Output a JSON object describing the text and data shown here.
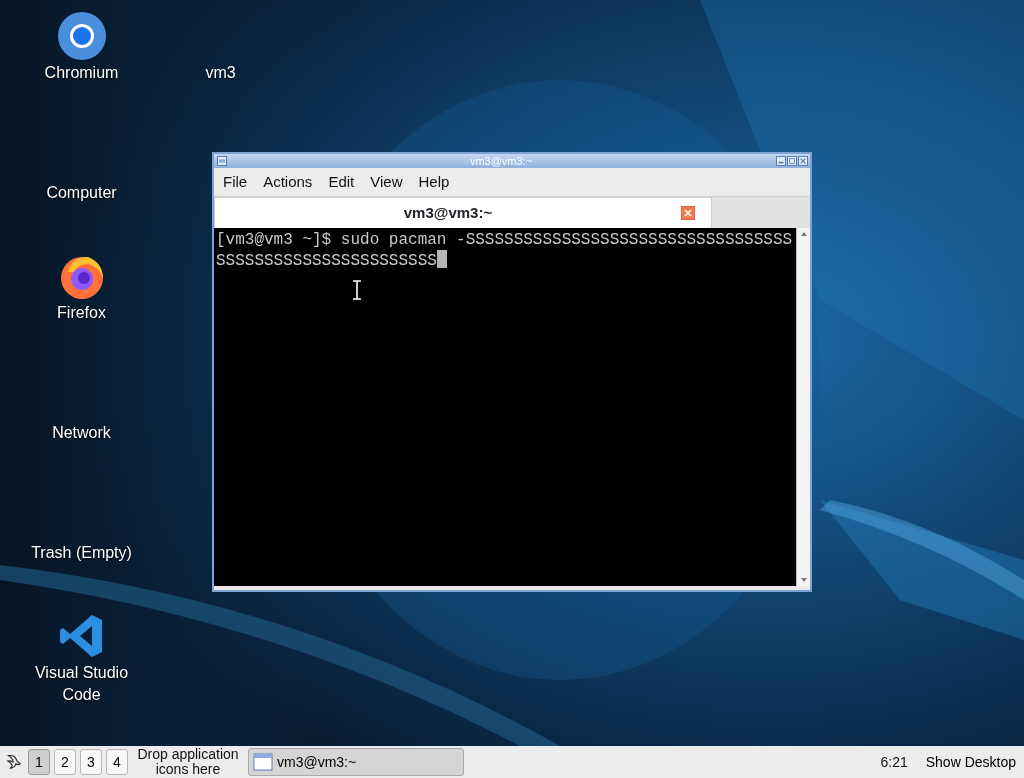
{
  "desktop_icons": [
    {
      "label": "Chromium",
      "kind": "chromium"
    },
    {
      "label": "Computer",
      "kind": "none"
    },
    {
      "label": "Firefox",
      "kind": "firefox"
    },
    {
      "label": "Network",
      "kind": "none"
    },
    {
      "label": "Trash (Empty)",
      "kind": "none"
    },
    {
      "label": "Visual Studio Code",
      "kind": "vscode"
    },
    {
      "label": "vm3",
      "kind": "none"
    }
  ],
  "window": {
    "title": "vm3@vm3:~",
    "menu": [
      "File",
      "Actions",
      "Edit",
      "View",
      "Help"
    ],
    "tabs": [
      {
        "label": "vm3@vm3:~",
        "selected": true
      }
    ],
    "terminal_lines": [
      "[vm3@vm3 ~]$ sudo pacman -SSSSSSSSSSSSSSSSSSSSSSSSSSSSSSSSSS",
      "SSSSSSSSSSSSSSSSSSSSSSS"
    ]
  },
  "taskbar": {
    "workspaces": [
      {
        "label": "1",
        "selected": true
      },
      {
        "label": "2",
        "selected": false
      },
      {
        "label": "3",
        "selected": false
      },
      {
        "label": "4",
        "selected": false
      }
    ],
    "launcher_hint": "Drop application icons here",
    "tasks": [
      {
        "label": "vm3@vm3:~"
      }
    ],
    "clock": "6:21",
    "show_desktop": "Show Desktop"
  }
}
